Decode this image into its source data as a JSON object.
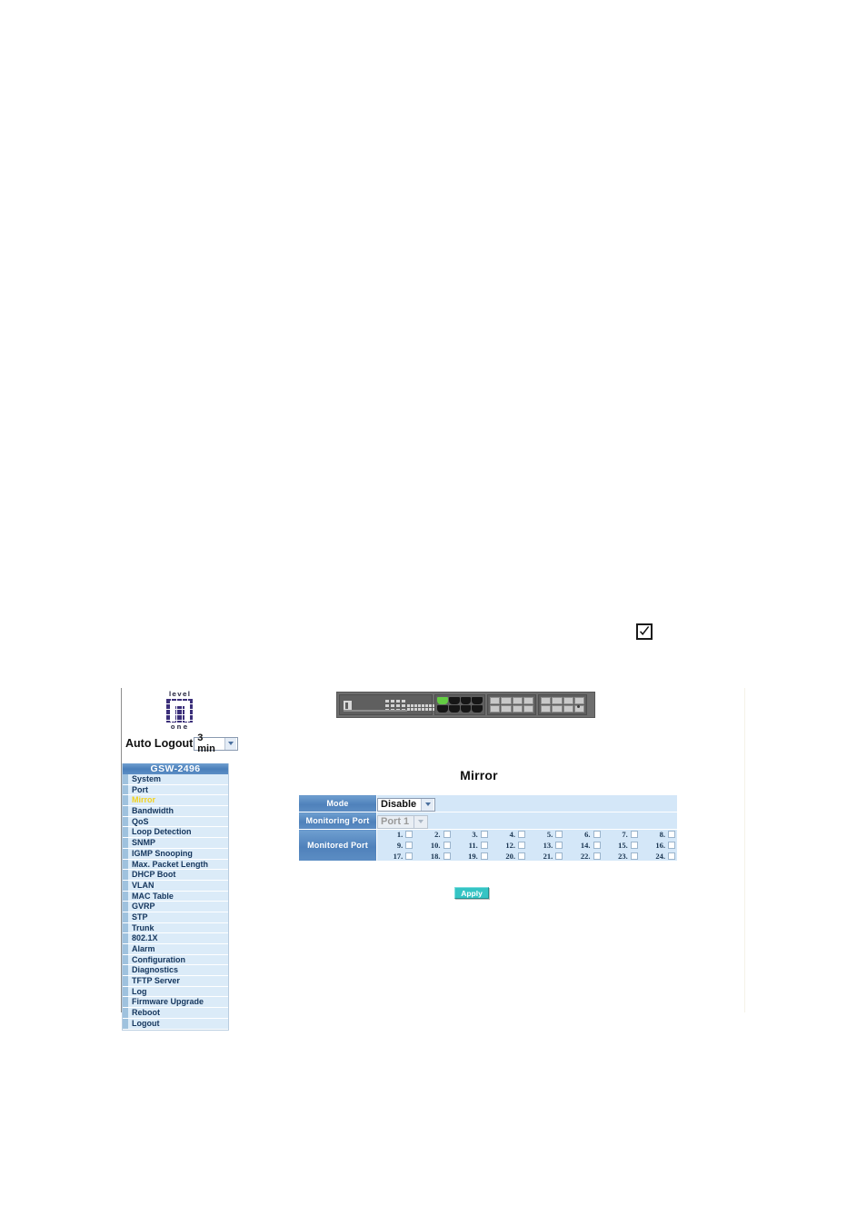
{
  "page": {
    "standalone_checkmark_icon": "checked-checkbox-icon"
  },
  "brand": {
    "logo_top_word": "level",
    "logo_bottom_word": "one"
  },
  "sidebar": {
    "auto_logout_label": "Auto Logout",
    "auto_logout_value": "3 min",
    "auto_logout_options": [
      "3 min"
    ],
    "model_title": "GSW-2496",
    "items": [
      {
        "label": "System",
        "active": false
      },
      {
        "label": "Port",
        "active": false
      },
      {
        "label": "Mirror",
        "active": true
      },
      {
        "label": "Bandwidth",
        "active": false
      },
      {
        "label": "QoS",
        "active": false
      },
      {
        "label": "Loop Detection",
        "active": false
      },
      {
        "label": "SNMP",
        "active": false
      },
      {
        "label": "IGMP Snooping",
        "active": false
      },
      {
        "label": "Max. Packet Length",
        "active": false
      },
      {
        "label": "DHCP Boot",
        "active": false
      },
      {
        "label": "VLAN",
        "active": false
      },
      {
        "label": "MAC Table",
        "active": false
      },
      {
        "label": "GVRP",
        "active": false
      },
      {
        "label": "STP",
        "active": false
      },
      {
        "label": "Trunk",
        "active": false
      },
      {
        "label": "802.1X",
        "active": false
      },
      {
        "label": "Alarm",
        "active": false
      },
      {
        "label": "Configuration",
        "active": false
      },
      {
        "label": "Diagnostics",
        "active": false
      },
      {
        "label": "TFTP Server",
        "active": false
      },
      {
        "label": "Log",
        "active": false
      },
      {
        "label": "Firmware Upgrade",
        "active": false
      },
      {
        "label": "Reboot",
        "active": false
      },
      {
        "label": "Logout",
        "active": false
      }
    ]
  },
  "device": {
    "name": "switch-front-panel-image",
    "rj45_port_count": 8,
    "rj45_lit_index": 0,
    "sfp_group_count": 2,
    "sfp_ports_per_group": 8
  },
  "main": {
    "title": "Mirror",
    "rows": {
      "mode_label": "Mode",
      "mode_value": "Disable",
      "mode_options": [
        "Disable"
      ],
      "monitoring_port_label": "Monitoring Port",
      "monitoring_port_value": "Port 1",
      "monitoring_port_options": [
        "Port 1"
      ],
      "monitoring_port_disabled": true,
      "monitored_port_label": "Monitored Port"
    },
    "monitored_ports": [
      "1.",
      "2.",
      "3.",
      "4.",
      "5.",
      "6.",
      "7.",
      "8.",
      "9.",
      "10.",
      "11.",
      "12.",
      "13.",
      "14.",
      "15.",
      "16.",
      "17.",
      "18.",
      "19.",
      "20.",
      "21.",
      "22.",
      "23.",
      "24."
    ],
    "apply_label": "Apply"
  },
  "colors": {
    "header_blue": "#4f81bb",
    "panel_blue": "#d4e7f8",
    "nav_item_blue": "#dbebf8",
    "active_yellow": "#f2d21e",
    "apply_teal": "#35c4c4"
  }
}
